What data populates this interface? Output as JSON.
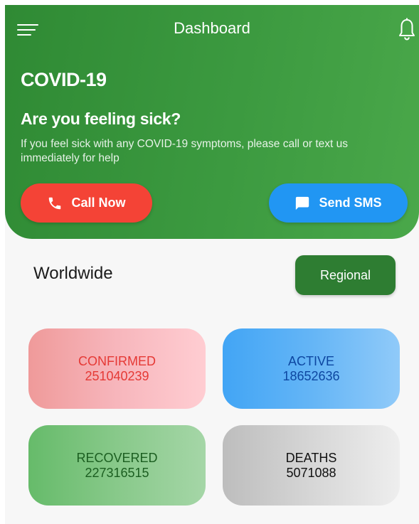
{
  "header": {
    "title": "Dashboard",
    "headline": "COVID-19",
    "question": "Are you feeling sick?",
    "description": "If you feel sick with any COVID-19 symptoms, please call or text us immediately for help",
    "call_button": "Call Now",
    "sms_button": "Send SMS"
  },
  "stats_header": {
    "label": "Worldwide",
    "regional_button": "Regional"
  },
  "stats": {
    "confirmed": {
      "label": "CONFIRMED",
      "value": "251040239"
    },
    "active": {
      "label": "ACTIVE",
      "value": "18652636"
    },
    "recovered": {
      "label": "RECOVERED",
      "value": "227316515"
    },
    "deaths": {
      "label": "DEATHS",
      "value": "5071088"
    }
  },
  "icons": {
    "menu": "menu-icon",
    "notification": "bell-icon",
    "call": "phone-icon",
    "sms": "message-icon"
  },
  "colors": {
    "primary_green": "#2e7d32",
    "call_red": "#f44336",
    "sms_blue": "#2196f3"
  }
}
